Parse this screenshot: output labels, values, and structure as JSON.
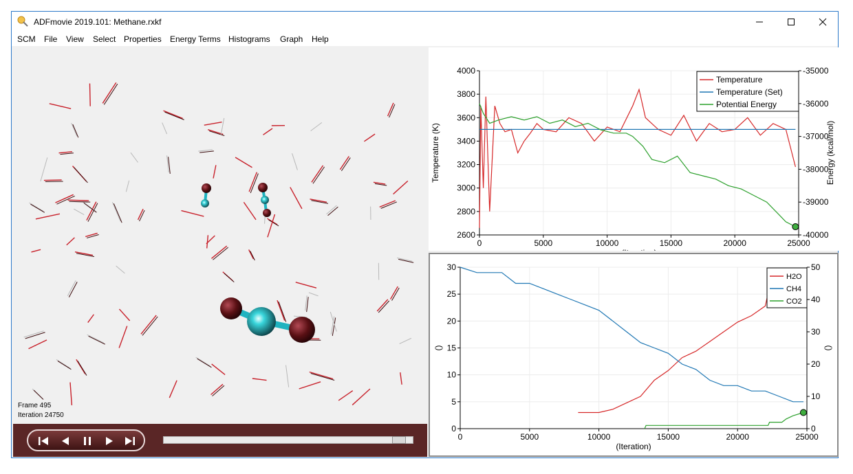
{
  "window": {
    "title": "ADFmovie 2019.101: Methane.rxkf"
  },
  "menu": [
    "SCM",
    "File",
    "View",
    "Select",
    "Properties",
    "Energy Terms",
    "Histograms",
    "Graph",
    "Help"
  ],
  "viewer": {
    "frame_label": "Frame 495",
    "iteration_label": "Iteration 24750"
  },
  "player": {
    "buttons": [
      "first-frame",
      "previous-frame",
      "pause",
      "next-frame",
      "last-frame"
    ],
    "progress": 0.97
  },
  "chart_data": [
    {
      "type": "line",
      "xlabel": "(Iteration)",
      "ylabel": "Temperature (K)",
      "y2label": "Energy (kcal/mol)",
      "xlim": [
        0,
        25000
      ],
      "ylim": [
        2600,
        4000
      ],
      "y2lim": [
        -40000,
        -35000
      ],
      "xticks": [
        "0",
        "5000",
        "10000",
        "15000",
        "20000",
        "25000"
      ],
      "yticks": [
        "2600",
        "2800",
        "3000",
        "3200",
        "3400",
        "3600",
        "3800",
        "4000"
      ],
      "y2ticks": [
        "-40000",
        "-39000",
        "-38000",
        "-37000",
        "-36000",
        "-35000"
      ],
      "legend_position": "top-right",
      "series": [
        {
          "name": "Temperature",
          "axis": "left",
          "color": "#d62728",
          "x": [
            0,
            100,
            300,
            500,
            800,
            1200,
            1600,
            2000,
            2500,
            3000,
            3500,
            4000,
            4500,
            5000,
            6000,
            7000,
            8000,
            9000,
            10000,
            11000,
            12000,
            12500,
            13000,
            14000,
            15000,
            16000,
            17000,
            18000,
            19000,
            20000,
            21000,
            22000,
            23000,
            24000,
            24750
          ],
          "y": [
            2660,
            3700,
            3000,
            3780,
            2800,
            3700,
            3550,
            3480,
            3500,
            3300,
            3400,
            3470,
            3550,
            3500,
            3480,
            3600,
            3550,
            3400,
            3520,
            3480,
            3700,
            3840,
            3600,
            3500,
            3450,
            3620,
            3400,
            3550,
            3480,
            3500,
            3600,
            3450,
            3550,
            3500,
            3180
          ]
        },
        {
          "name": "Temperature (Set)",
          "axis": "left",
          "color": "#1f77b4",
          "x": [
            0,
            24750
          ],
          "y": [
            3500,
            3500
          ]
        },
        {
          "name": "Potential Energy",
          "axis": "right",
          "color": "#2ca02c",
          "x": [
            0,
            300,
            800,
            1500,
            2500,
            3500,
            4500,
            5500,
            6500,
            7500,
            8500,
            9500,
            10500,
            11500,
            12000,
            12800,
            13500,
            14500,
            15500,
            16500,
            17500,
            18500,
            19500,
            20500,
            21500,
            22500,
            23500,
            24000,
            24750
          ],
          "y": [
            -36000,
            -36300,
            -36600,
            -36500,
            -36400,
            -36500,
            -36400,
            -36600,
            -36500,
            -36700,
            -36600,
            -36800,
            -36900,
            -36900,
            -37000,
            -37300,
            -37700,
            -37800,
            -37600,
            -38100,
            -38200,
            -38300,
            -38500,
            -38600,
            -38800,
            -39000,
            -39400,
            -39600,
            -39750
          ]
        }
      ]
    },
    {
      "type": "line",
      "xlabel": "(Iteration)",
      "ylabel": "()",
      "y2label": "()",
      "xlim": [
        0,
        25000
      ],
      "ylim": [
        0,
        30
      ],
      "y2lim": [
        0,
        50
      ],
      "xticks": [
        "0",
        "5000",
        "10000",
        "15000",
        "20000",
        "25000"
      ],
      "yticks": [
        "0",
        "5",
        "10",
        "15",
        "20",
        "25",
        "30"
      ],
      "y2ticks": [
        "0",
        "10",
        "20",
        "30",
        "40",
        "50"
      ],
      "legend_position": "top-right",
      "series": [
        {
          "name": "H2O",
          "axis": "right",
          "color": "#d62728",
          "x": [
            8500,
            9000,
            10000,
            11000,
            12000,
            13000,
            14000,
            15000,
            16000,
            17000,
            18000,
            19000,
            20000,
            21000,
            22000,
            22200
          ],
          "y": [
            5,
            5,
            5,
            6,
            8,
            10,
            15,
            18,
            22,
            24,
            27,
            30,
            33,
            35,
            38,
            42
          ]
        },
        {
          "name": "CH4",
          "axis": "left",
          "color": "#1f77b4",
          "x": [
            0,
            1200,
            3000,
            4000,
            5000,
            6000,
            7000,
            8000,
            9000,
            10000,
            11000,
            12000,
            13000,
            14000,
            15000,
            16000,
            17000,
            18000,
            19000,
            20000,
            21000,
            22000,
            23000,
            24000,
            24750
          ],
          "y": [
            30,
            29,
            29,
            27,
            27,
            26,
            25,
            24,
            23,
            22,
            20,
            18,
            16,
            15,
            14,
            12,
            11,
            9,
            8,
            8,
            7,
            7,
            6,
            5,
            5
          ]
        },
        {
          "name": "CO2",
          "axis": "right",
          "color": "#2ca02c",
          "x": [
            13300,
            13400,
            22200,
            22300,
            23200,
            23500,
            24000,
            24750
          ],
          "y": [
            0,
            1,
            1,
            2,
            2,
            3,
            4,
            5
          ]
        }
      ]
    }
  ]
}
